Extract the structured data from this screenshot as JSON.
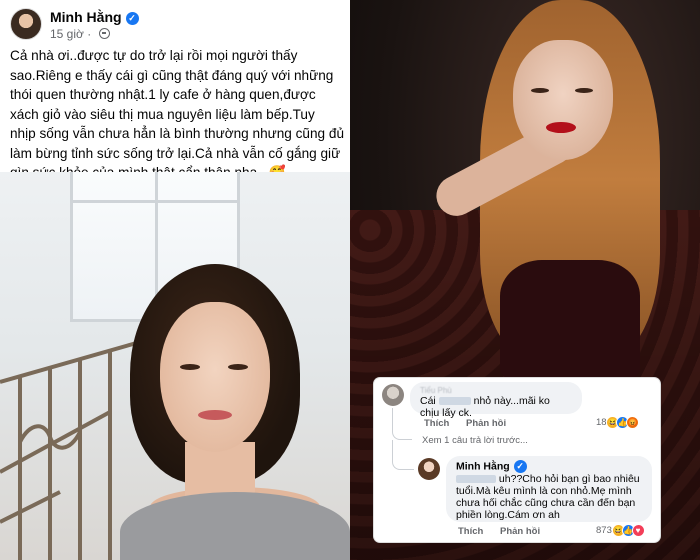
{
  "post": {
    "author": "Minh Hằng",
    "time": "15 giờ",
    "text": "Cả nhà ơi..được tự do trở lại rồi mọi người thấy sao.Riêng e thấy cái gì cũng thật đáng quý với những thói quen thường nhật.1 ly cafe ở hàng quen,được xách giỏ vào siêu thị mua nguyên liệu làm bếp.Tuy nhịp sống vẫn chưa hẳn là bình thường nhưng cũng đủ làm bừng tỉnh sức sống trở lại.Cả nhà vẫn cố gắng giữ gìn sức khỏe của mình thật cẩn thận nha...🥰"
  },
  "comments": [
    {
      "author": "Tiểu Phù",
      "text_before": "Cái",
      "text_after": "nhỏ này...mãi ko chịu lấy ck.",
      "like": "Thích",
      "reply": "Phản hồi",
      "reaction_count": "18"
    }
  ],
  "more_replies": "Xem 1 câu trả lời trước...",
  "reply": {
    "author": "Minh Hằng",
    "text_before": "",
    "text_after": "uh??Cho hỏi bạn gì bao nhiêu tuổi.Mà kêu mình là con nhỏ.Mẹ mình chưa hối chắc cũng chưa cần đến bạn phiền lòng.Cám ơn ah",
    "like": "Thích",
    "reply": "Phản hồi",
    "reaction_count": "873"
  },
  "colors": {
    "facebook_blue": "#1877f2",
    "bubble_bg": "#f0f2f5",
    "meta_gray": "#65676b"
  }
}
